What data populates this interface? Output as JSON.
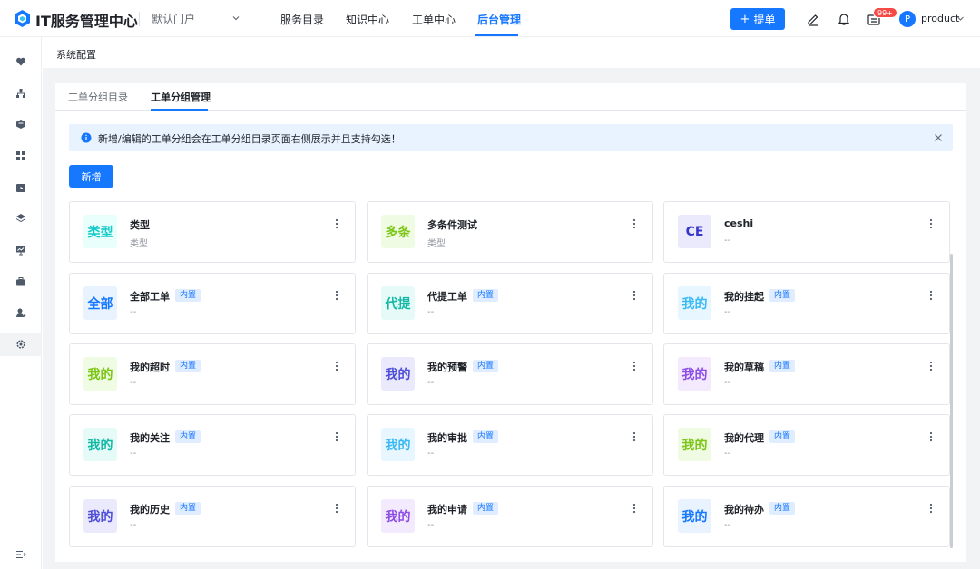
{
  "header": {
    "app_title": "IT服务管理中心",
    "portal_select": "默认门户",
    "nav": [
      {
        "label": "服务目录"
      },
      {
        "label": "知识中心"
      },
      {
        "label": "工单中心"
      },
      {
        "label": "后台管理"
      }
    ],
    "active_nav": "后台管理",
    "create_button": "提单",
    "notification_badge": "99+",
    "avatar_letter": "P",
    "username": "product",
    "accent_color": "#1677ff"
  },
  "sidebar": {
    "items": [
      {
        "icon": "heart-icon"
      },
      {
        "icon": "org-tree-icon"
      },
      {
        "icon": "cube-icon"
      },
      {
        "icon": "grid-icon"
      },
      {
        "icon": "folder-clock-icon"
      },
      {
        "icon": "layers-icon"
      },
      {
        "icon": "monitor-icon"
      },
      {
        "icon": "briefcase-icon"
      },
      {
        "icon": "user-settings-icon"
      },
      {
        "icon": "gear-icon"
      }
    ],
    "active_icon": "gear-icon",
    "collapse_icon": "collapse-menu-icon"
  },
  "breadcrumb": "系统配置",
  "tabs": [
    {
      "label": "工单分组目录"
    },
    {
      "label": "工单分组管理"
    }
  ],
  "active_tab": "工单分组管理",
  "alert": {
    "text": "新增/编辑的工单分组会在工单分组目录页面右侧展示并且支持勾选！"
  },
  "add_button": "新增",
  "builtin_tag": "内置",
  "cards": [
    {
      "icon_text": "类型",
      "name": "类型",
      "sub": "类型",
      "builtin": false,
      "color": "#14c9c9",
      "bg": "#e8fffb"
    },
    {
      "icon_text": "多条",
      "name": "多条件测试",
      "sub": "类型",
      "builtin": false,
      "color": "#7bc616",
      "bg": "#f0fbe3"
    },
    {
      "icon_text": "CE",
      "name": "ceshi",
      "sub": "--",
      "builtin": false,
      "color": "#3636c9",
      "bg": "#ebeafc"
    },
    {
      "icon_text": "全部",
      "name": "全部工单",
      "sub": "--",
      "builtin": true,
      "color": "#1677ff",
      "bg": "#e8f3ff"
    },
    {
      "icon_text": "代提",
      "name": "代提工单",
      "sub": "--",
      "builtin": true,
      "color": "#14b8a6",
      "bg": "#e6fbf7"
    },
    {
      "icon_text": "我的",
      "name": "我的挂起",
      "sub": "--",
      "builtin": true,
      "color": "#3bb9f5",
      "bg": "#e8f7ff"
    },
    {
      "icon_text": "我的",
      "name": "我的超时",
      "sub": "--",
      "builtin": true,
      "color": "#7bc616",
      "bg": "#f0fbe3"
    },
    {
      "icon_text": "我的",
      "name": "我的预警",
      "sub": "--",
      "builtin": true,
      "color": "#4e4ed6",
      "bg": "#ebeafc"
    },
    {
      "icon_text": "我的",
      "name": "我的草稿",
      "sub": "--",
      "builtin": true,
      "color": "#8d4ee6",
      "bg": "#f3ebfd"
    },
    {
      "icon_text": "我的",
      "name": "我的关注",
      "sub": "--",
      "builtin": true,
      "color": "#14b8a6",
      "bg": "#e6fbf7"
    },
    {
      "icon_text": "我的",
      "name": "我的审批",
      "sub": "--",
      "builtin": true,
      "color": "#3bb9f5",
      "bg": "#e8f7ff"
    },
    {
      "icon_text": "我的",
      "name": "我的代理",
      "sub": "--",
      "builtin": true,
      "color": "#7bc616",
      "bg": "#f0fbe3"
    },
    {
      "icon_text": "我的",
      "name": "我的历史",
      "sub": "--",
      "builtin": true,
      "color": "#4e4ed6",
      "bg": "#ebeafc"
    },
    {
      "icon_text": "我的",
      "name": "我的申请",
      "sub": "--",
      "builtin": true,
      "color": "#8d4ee6",
      "bg": "#f3ebfd"
    },
    {
      "icon_text": "我的",
      "name": "我的待办",
      "sub": "--",
      "builtin": true,
      "color": "#1677ff",
      "bg": "#e8f3ff"
    }
  ]
}
